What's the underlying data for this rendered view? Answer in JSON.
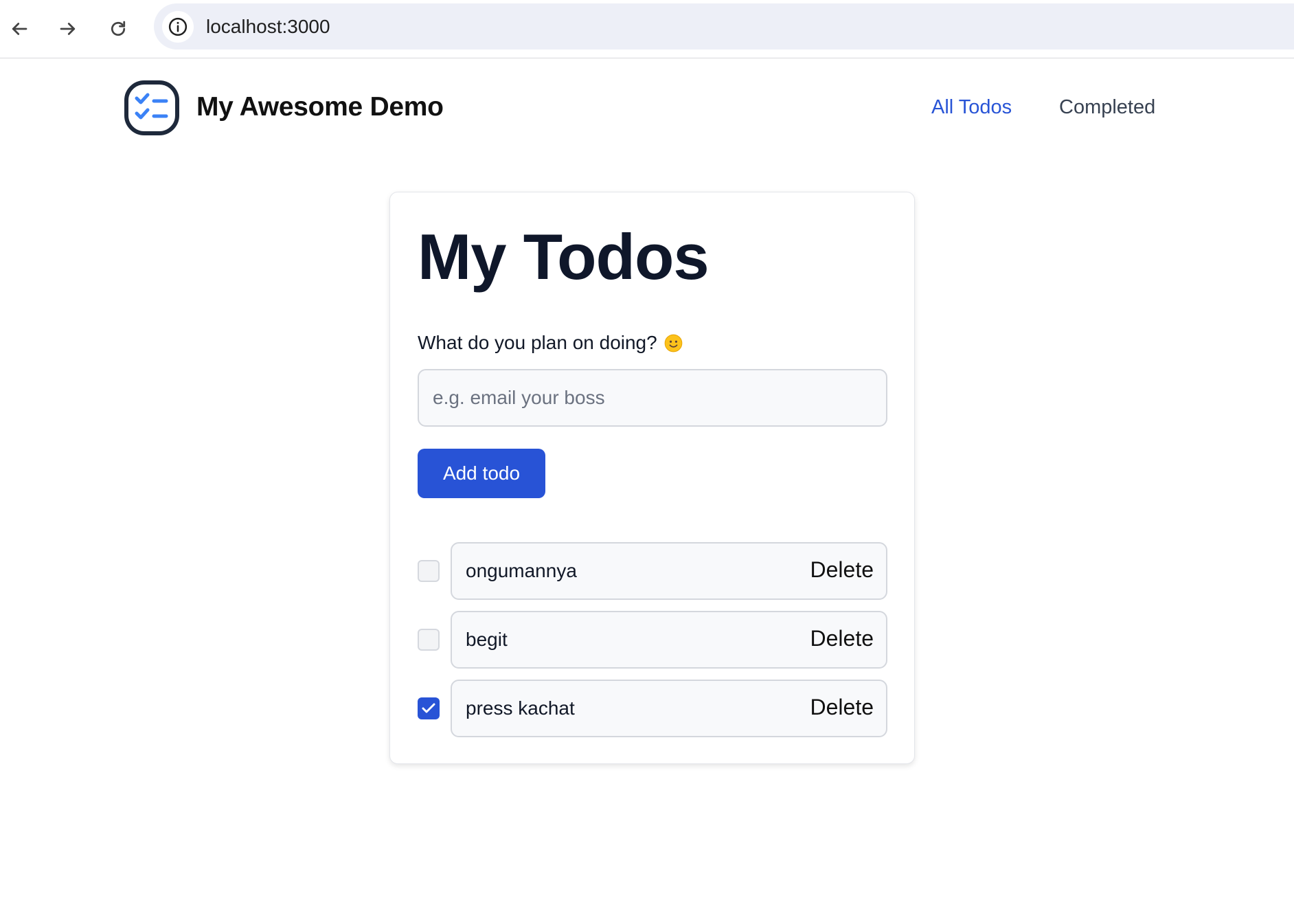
{
  "browser": {
    "url": "localhost:3000",
    "back_icon": "arrow-left-icon",
    "forward_icon": "arrow-right-icon",
    "reload_icon": "reload-icon",
    "site_info_icon": "info-circle-icon"
  },
  "header": {
    "logo_icon": "checklist-logo-icon",
    "brand": "My Awesome Demo",
    "nav": {
      "all": "All Todos",
      "completed": "Completed"
    },
    "active_nav": "All Todos"
  },
  "card": {
    "title": "My Todos",
    "prompt": "What do you plan on doing?",
    "prompt_emoji": "slightly-smiling-face",
    "input": {
      "value": "",
      "placeholder": "e.g. email your boss"
    },
    "add_button": "Add todo",
    "todos": [
      {
        "text": "ongumannya",
        "completed": false,
        "delete_label": "Delete"
      },
      {
        "text": "begit",
        "completed": false,
        "delete_label": "Delete"
      },
      {
        "text": "press kachat",
        "completed": true,
        "delete_label": "Delete"
      }
    ]
  },
  "colors": {
    "accent": "#2853d6",
    "nav_active": "#2854d6",
    "logo_check": "#3b82f6",
    "logo_frame": "#1e293b"
  }
}
